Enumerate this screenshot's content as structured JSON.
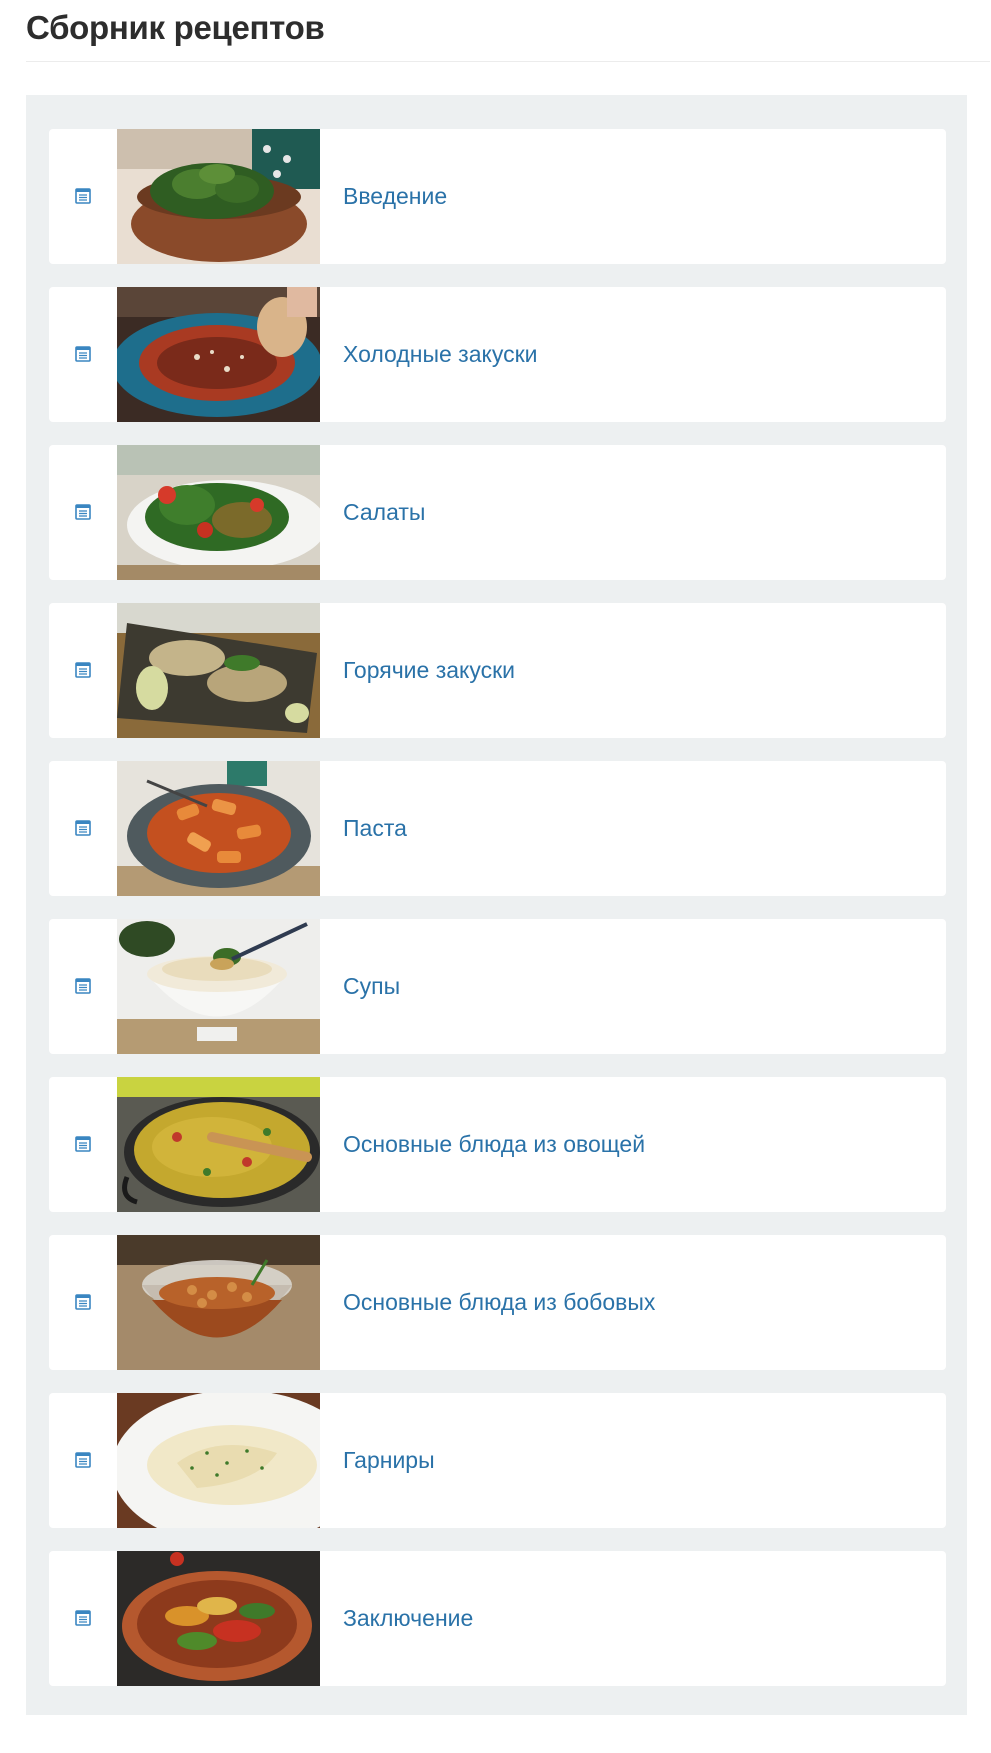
{
  "page": {
    "title": "Сборник рецептов"
  },
  "colors": {
    "link": "#2a72a8",
    "panel_bg": "#edf0f1",
    "title": "#2d2d2d",
    "icon": "#3a86c1"
  },
  "items": [
    {
      "label": "Введение",
      "icon": "document-list-icon",
      "image": "salad-greens-in-coconut-bowl"
    },
    {
      "label": "Холодные закуски",
      "icon": "document-list-icon",
      "image": "flatbread-with-tomato-spread-on-blue-plate"
    },
    {
      "label": "Салаты",
      "icon": "document-list-icon",
      "image": "green-salad-with-tomatoes-in-white-bowl"
    },
    {
      "label": "Горячие закуски",
      "icon": "document-list-icon",
      "image": "fried-patties-with-sauce-on-tray"
    },
    {
      "label": "Паста",
      "icon": "document-list-icon",
      "image": "rigatoni-in-tomato-sauce"
    },
    {
      "label": "Супы",
      "icon": "document-list-icon",
      "image": "cream-soup-in-white-bowl"
    },
    {
      "label": "Основные блюда из овощей",
      "icon": "document-list-icon",
      "image": "vegetable-paella-in-pan"
    },
    {
      "label": "Основные блюда из бобовых",
      "icon": "document-list-icon",
      "image": "chickpea-stew-in-glass-bowl"
    },
    {
      "label": "Гарниры",
      "icon": "document-list-icon",
      "image": "mashed-potatoes-on-plate"
    },
    {
      "label": "Заключение",
      "icon": "document-list-icon",
      "image": "vegetable-tian-in-clay-dish"
    }
  ]
}
